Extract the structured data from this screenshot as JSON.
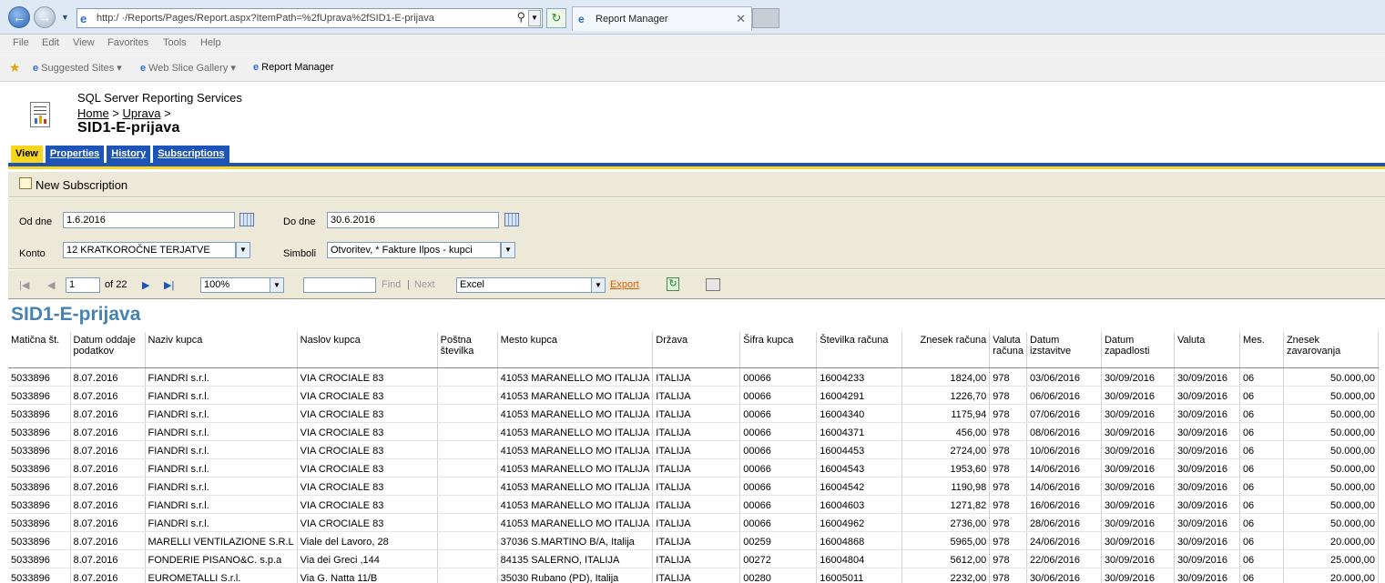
{
  "browser": {
    "url": "http:/              ·/Reports/Pages/Report.aspx?ItemPath=%2fUprava%2fSID1-E-prijava",
    "tab_title": "Report Manager",
    "menu": [
      "File",
      "Edit",
      "View",
      "Favorites",
      "Tools",
      "Help"
    ],
    "favorites": [
      "Suggested Sites ▾",
      "Web Slice Gallery ▾",
      "Report Manager"
    ]
  },
  "header": {
    "app_title": "SQL Server Reporting Services",
    "breadcrumb_home": "Home",
    "breadcrumb_uprava": "Uprava",
    "sep": ">",
    "page_title": "SID1-E-prijava",
    "tabs": [
      "View",
      "Properties",
      "History",
      "Subscriptions"
    ]
  },
  "subscription": {
    "new_label": "New Subscription"
  },
  "params": {
    "od_dne_label": "Od dne",
    "od_dne_value": "1.6.2016",
    "do_dne_label": "Do dne",
    "do_dne_value": "30.6.2016",
    "konto_label": "Konto",
    "konto_value": "12     KRATKOROČNE TERJATVE",
    "simboli_label": "Simboli",
    "simboli_value": "Otvoritev, * Fakture Ilpos - kupci"
  },
  "toolbar": {
    "page": "1",
    "of": "of 22",
    "zoom": "100%",
    "find": "Find",
    "sep": "|",
    "next": "Next",
    "export_format": "Excel",
    "export": "Export"
  },
  "report": {
    "title": "SID1-E-prijava",
    "columns": [
      "Matična št.",
      "Datum oddaje podatkov",
      "Naziv kupca",
      "Naslov kupca",
      "Poštna številka",
      "Mesto kupca",
      "Država",
      "Šifra kupca",
      "Številka računa",
      "Znesek računa",
      "Valuta računa",
      "Datum izstavitve",
      "Datum zapadlosti",
      "Valuta",
      "Mes.",
      "Znesek zavarovanja"
    ],
    "rows": [
      [
        "5033896",
        "8.07.2016",
        "FIANDRI s.r.l.",
        "VIA CROCIALE 83",
        "",
        "41053 MARANELLO MO ITALIJA",
        "ITALIJA",
        "00066",
        "16004233",
        "1824,00",
        "978",
        "03/06/2016",
        "30/09/2016",
        "30/09/2016",
        "06",
        "50.000,00"
      ],
      [
        "5033896",
        "8.07.2016",
        "FIANDRI s.r.l.",
        "VIA CROCIALE 83",
        "",
        "41053 MARANELLO MO ITALIJA",
        "ITALIJA",
        "00066",
        "16004291",
        "1226,70",
        "978",
        "06/06/2016",
        "30/09/2016",
        "30/09/2016",
        "06",
        "50.000,00"
      ],
      [
        "5033896",
        "8.07.2016",
        "FIANDRI s.r.l.",
        "VIA CROCIALE 83",
        "",
        "41053 MARANELLO MO ITALIJA",
        "ITALIJA",
        "00066",
        "16004340",
        "1175,94",
        "978",
        "07/06/2016",
        "30/09/2016",
        "30/09/2016",
        "06",
        "50.000,00"
      ],
      [
        "5033896",
        "8.07.2016",
        "FIANDRI s.r.l.",
        "VIA CROCIALE 83",
        "",
        "41053 MARANELLO MO ITALIJA",
        "ITALIJA",
        "00066",
        "16004371",
        "456,00",
        "978",
        "08/06/2016",
        "30/09/2016",
        "30/09/2016",
        "06",
        "50.000,00"
      ],
      [
        "5033896",
        "8.07.2016",
        "FIANDRI s.r.l.",
        "VIA CROCIALE 83",
        "",
        "41053 MARANELLO MO ITALIJA",
        "ITALIJA",
        "00066",
        "16004453",
        "2724,00",
        "978",
        "10/06/2016",
        "30/09/2016",
        "30/09/2016",
        "06",
        "50.000,00"
      ],
      [
        "5033896",
        "8.07.2016",
        "FIANDRI s.r.l.",
        "VIA CROCIALE 83",
        "",
        "41053 MARANELLO MO ITALIJA",
        "ITALIJA",
        "00066",
        "16004543",
        "1953,60",
        "978",
        "14/06/2016",
        "30/09/2016",
        "30/09/2016",
        "06",
        "50.000,00"
      ],
      [
        "5033896",
        "8.07.2016",
        "FIANDRI s.r.l.",
        "VIA CROCIALE 83",
        "",
        "41053 MARANELLO MO ITALIJA",
        "ITALIJA",
        "00066",
        "16004542",
        "1190,98",
        "978",
        "14/06/2016",
        "30/09/2016",
        "30/09/2016",
        "06",
        "50.000,00"
      ],
      [
        "5033896",
        "8.07.2016",
        "FIANDRI s.r.l.",
        "VIA CROCIALE 83",
        "",
        "41053 MARANELLO MO ITALIJA",
        "ITALIJA",
        "00066",
        "16004603",
        "1271,82",
        "978",
        "16/06/2016",
        "30/09/2016",
        "30/09/2016",
        "06",
        "50.000,00"
      ],
      [
        "5033896",
        "8.07.2016",
        "FIANDRI s.r.l.",
        "VIA CROCIALE 83",
        "",
        "41053 MARANELLO MO ITALIJA",
        "ITALIJA",
        "00066",
        "16004962",
        "2736,00",
        "978",
        "28/06/2016",
        "30/09/2016",
        "30/09/2016",
        "06",
        "50.000,00"
      ],
      [
        "5033896",
        "8.07.2016",
        "MARELLI VENTILAZIONE S.R.L",
        "Viale del Lavoro, 28",
        "",
        "37036 S.MARTINO B/A, Italija",
        "ITALIJA",
        "00259",
        "16004868",
        "5965,00",
        "978",
        "24/06/2016",
        "30/09/2016",
        "30/09/2016",
        "06",
        "20.000,00"
      ],
      [
        "5033896",
        "8.07.2016",
        "FONDERIE PISANO&C. s.p.a",
        "Via dei Greci ,144",
        "",
        "84135 SALERNO, ITALIJA",
        "ITALIJA",
        "00272",
        "16004804",
        "5612,00",
        "978",
        "22/06/2016",
        "30/09/2016",
        "30/09/2016",
        "06",
        "25.000,00"
      ],
      [
        "5033896",
        "8.07.2016",
        "EUROMETALLI S.r.l.",
        "Via G. Natta 11/B",
        "",
        "35030 Rubano (PD), Italija",
        "ITALIJA",
        "00280",
        "16005011",
        "2232,00",
        "978",
        "30/06/2016",
        "30/09/2016",
        "30/09/2016",
        "06",
        "20.000,00"
      ]
    ]
  }
}
